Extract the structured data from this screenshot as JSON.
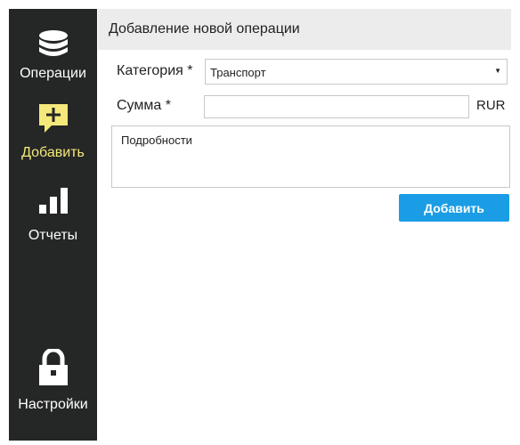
{
  "sidebar": {
    "items": [
      {
        "label": "Операции",
        "icon": "database-icon",
        "active": false
      },
      {
        "label": "Добавить",
        "icon": "add-comment-icon",
        "active": true
      },
      {
        "label": "Отчеты",
        "icon": "bar-chart-icon",
        "active": false
      },
      {
        "label": "Настройки",
        "icon": "lock-icon",
        "active": false
      }
    ],
    "colors": {
      "background": "#252626",
      "active_label": "#f4e97a",
      "active_icon": "#f4e97a",
      "icon": "#ffffff"
    }
  },
  "form": {
    "title": "Добавление новой операции",
    "category_label": "Категория *",
    "category_value": "Транспорт",
    "amount_label": "Сумма *",
    "amount_value": "",
    "currency": "RUR",
    "details_placeholder": "Подробности",
    "submit_label": "Добавить",
    "accent_color": "#1b9de5"
  }
}
